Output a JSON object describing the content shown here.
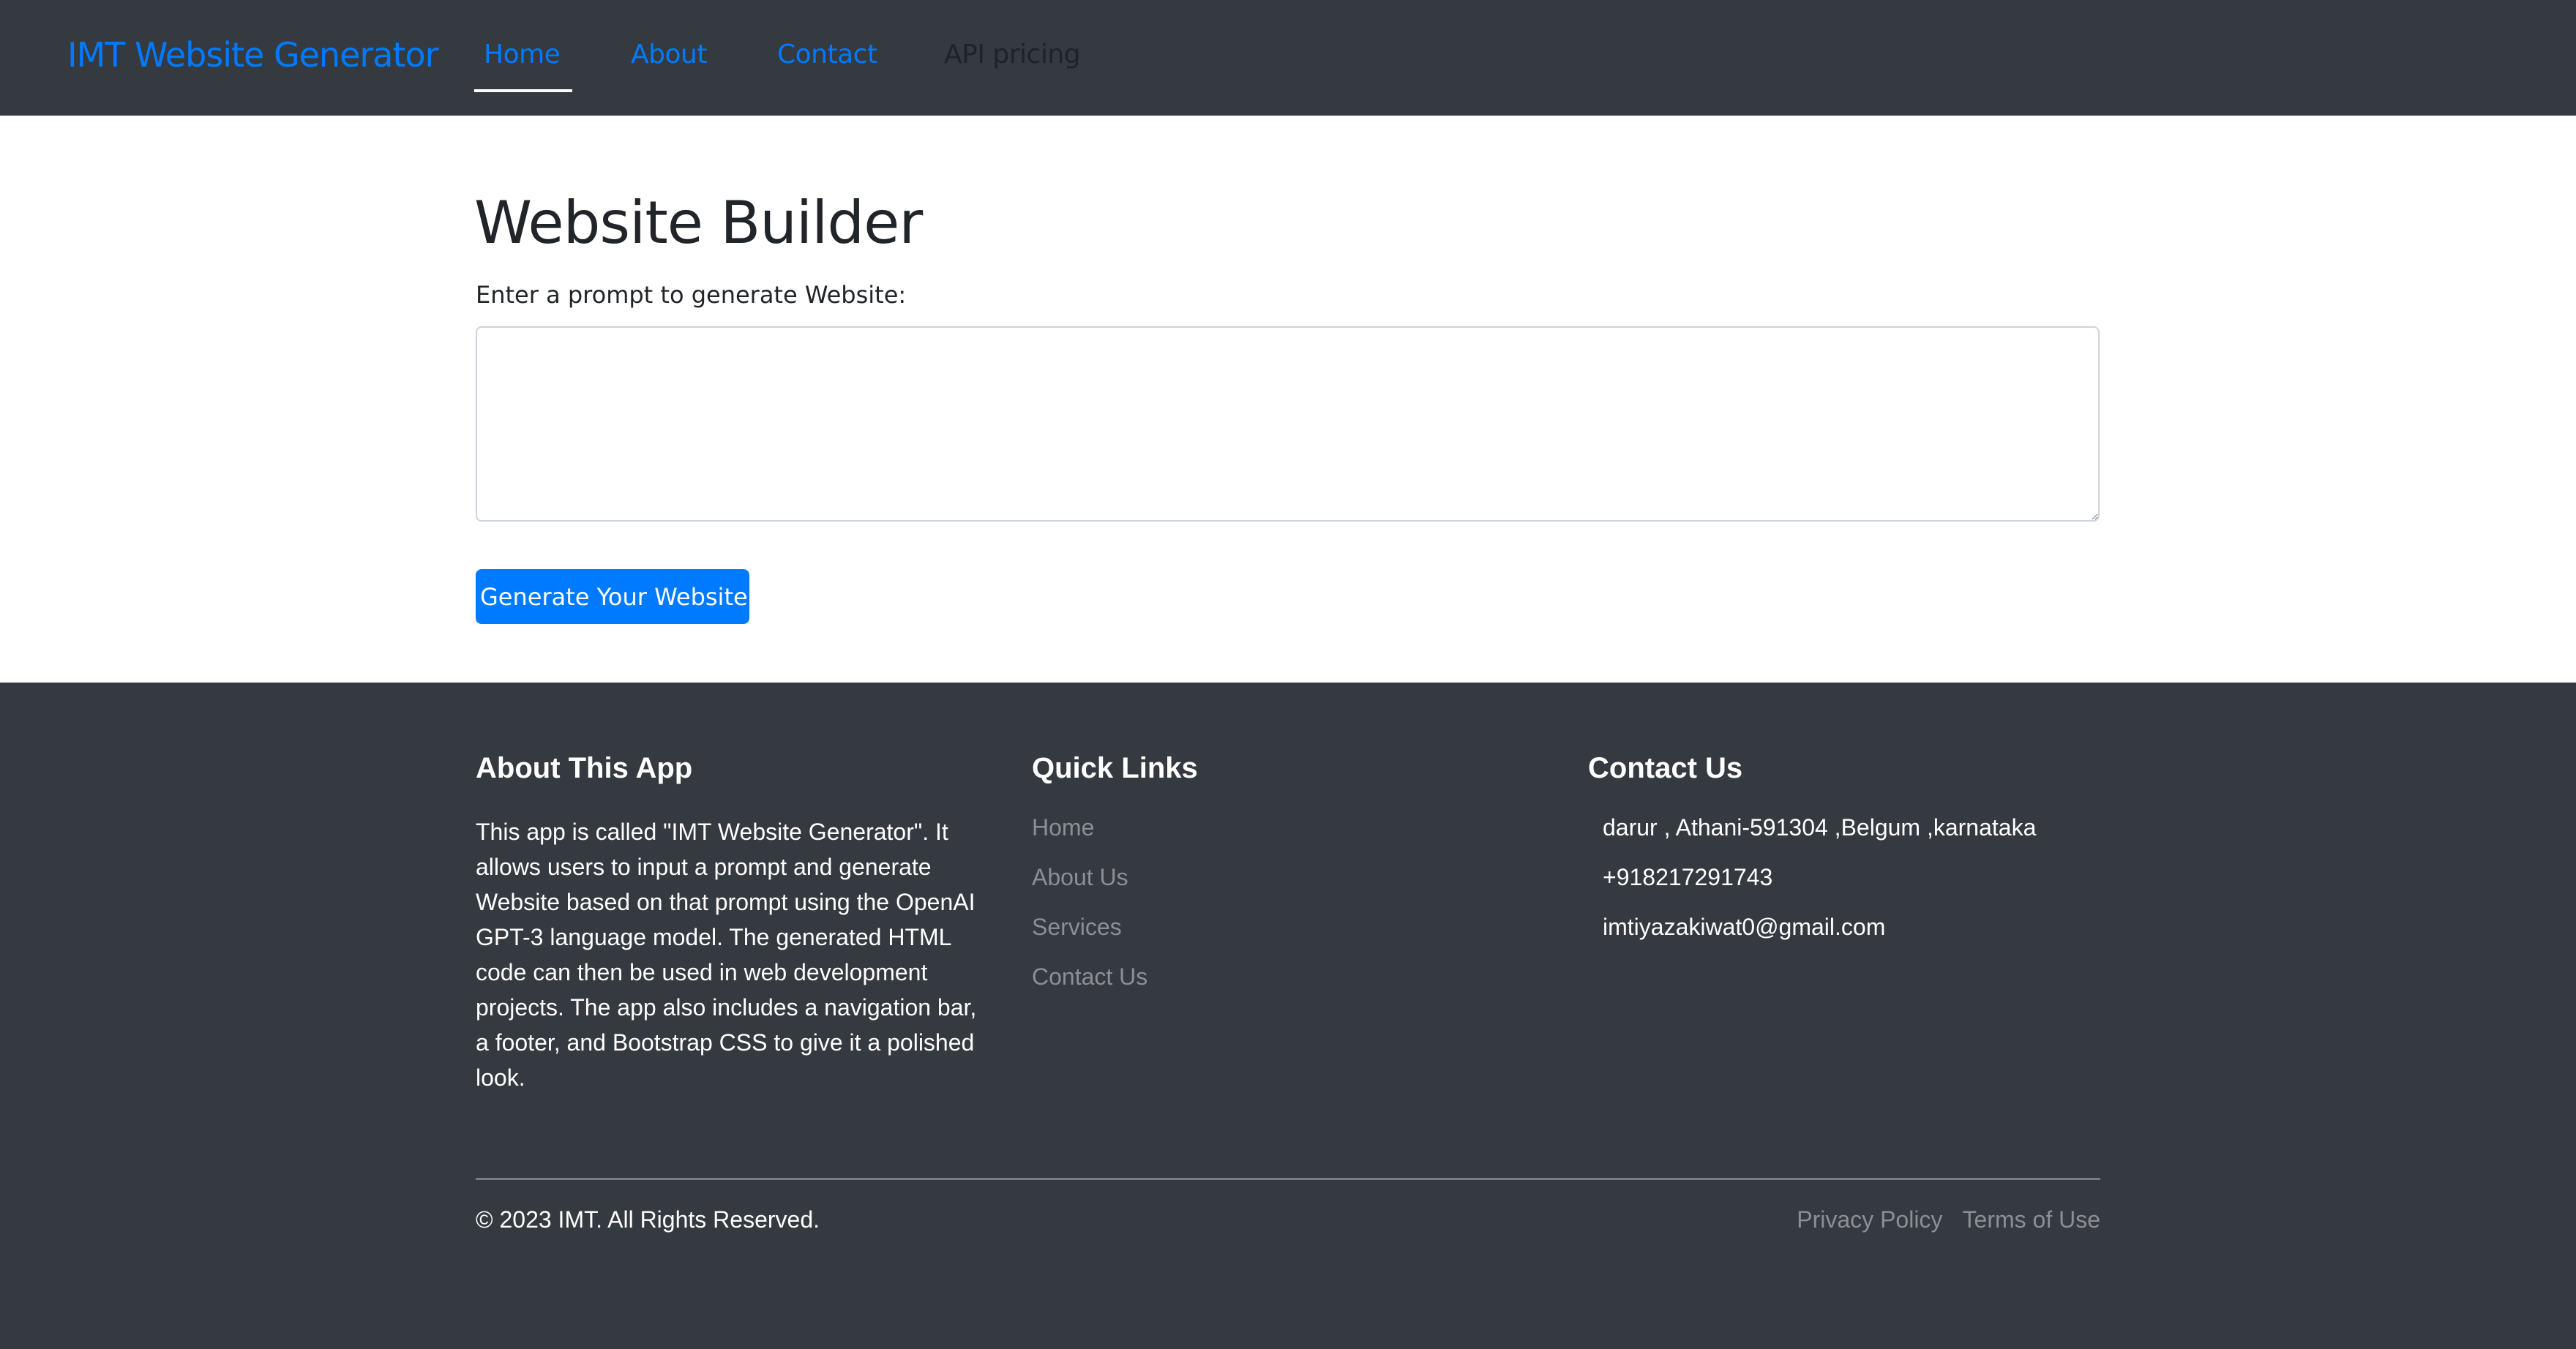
{
  "navbar": {
    "brand": "IMT Website Generator",
    "links": [
      {
        "label": "Home",
        "active": true
      },
      {
        "label": "About",
        "active": false
      },
      {
        "label": "Contact",
        "active": false
      },
      {
        "label": "API pricing",
        "active": false
      }
    ]
  },
  "main": {
    "title": "Website Builder",
    "prompt_label": "Enter a prompt to generate Website:",
    "prompt_value": "",
    "prompt_placeholder": "",
    "generate_button": "Generate Your Website"
  },
  "footer": {
    "about": {
      "heading": "About This App",
      "text": "This app is called \"IMT Website Generator\". It allows users to input a prompt and generate Website based on that prompt using the OpenAI GPT-3 language model. The generated HTML code can then be used in web development projects. The app also includes a navigation bar, a footer, and Bootstrap CSS to give it a polished look."
    },
    "quick_links": {
      "heading": "Quick Links",
      "items": [
        "Home",
        "About Us",
        "Services",
        "Contact Us"
      ]
    },
    "contact": {
      "heading": "Contact Us",
      "address": "darur , Athani-591304 ,Belgum ,karnataka",
      "phone": "+918217291743",
      "email": "imtiyazakiwat0@gmail.com"
    },
    "copyright": "© 2023 IMT. All Rights Reserved.",
    "legal_links": [
      "Privacy Policy",
      "Terms of Use"
    ]
  },
  "colors": {
    "primary": "#007bff",
    "dark": "#343a40",
    "muted_link": "#8c8f93"
  }
}
